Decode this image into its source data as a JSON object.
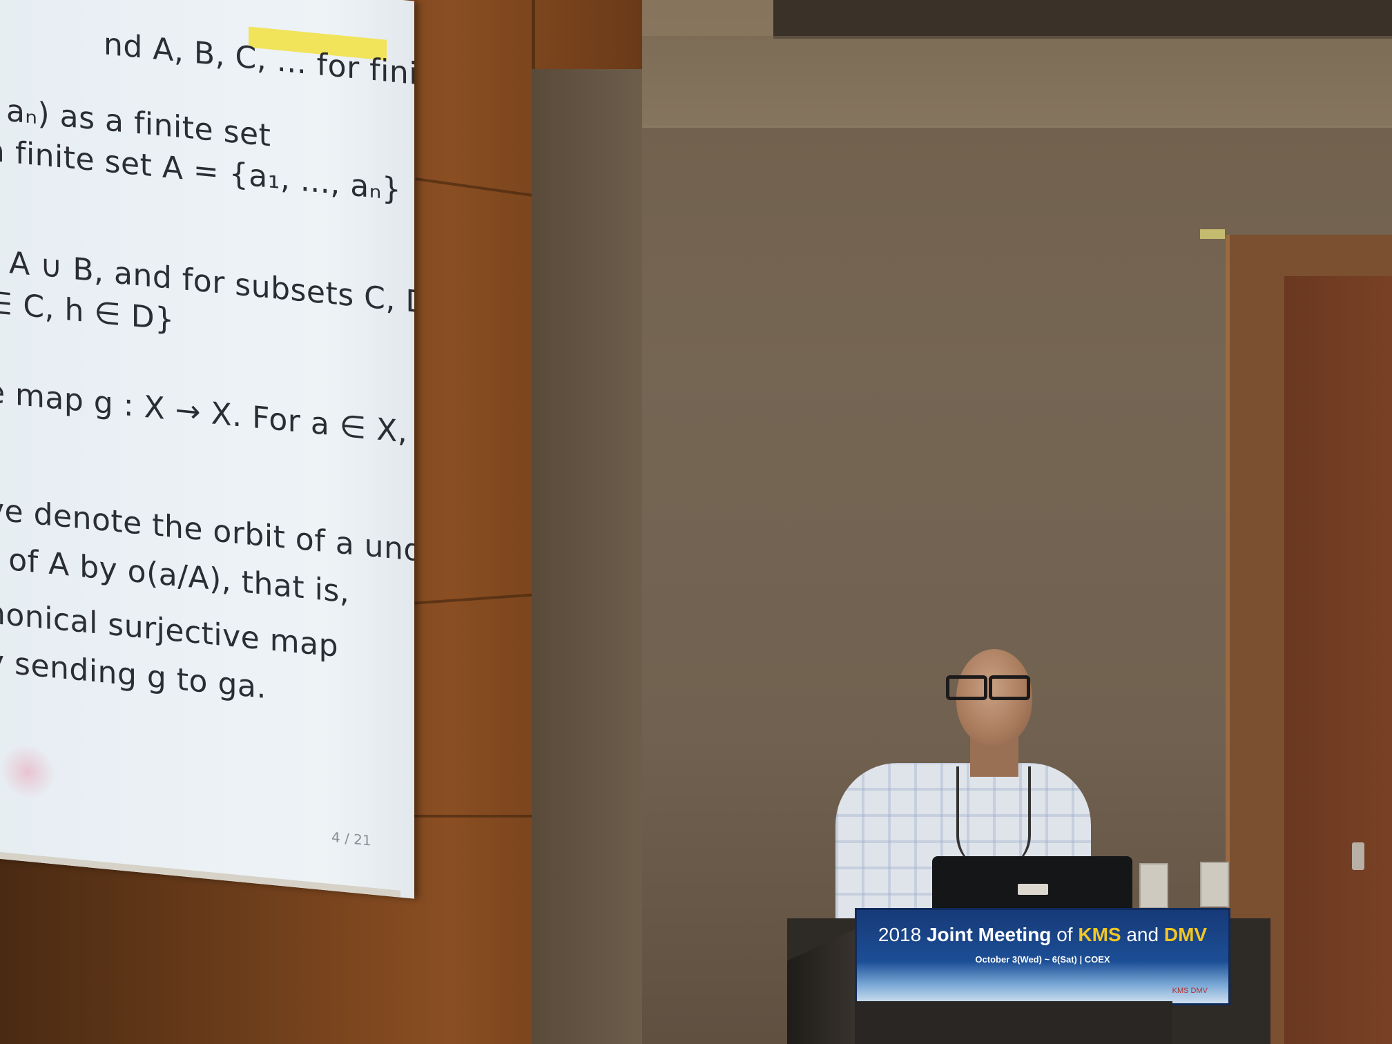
{
  "slide": {
    "lines": [
      "nd A, B, C, ... for finite",
      ", aₙ) as a finite set",
      "a finite set A = {a₁, ..., aₙ}",
      "r A ∪ B, and for subsets C, D",
      "∈ C, h ∈ D}",
      "e map g : X → X. For a ∈ X,",
      "ve denote the orbit of a under",
      "ₐ of A by o(a/A), that is,",
      "nonical surjective map",
      "y sending g to ga."
    ],
    "page_number": "4 / 21"
  },
  "banner": {
    "year": "2018",
    "joint": "Joint Meeting",
    "of": "of",
    "kms": "KMS",
    "and": "and",
    "dmv": "DMV",
    "dates": "October 3(Wed) ~ 6(Sat) | COEX",
    "logos": "KMS DMV"
  },
  "colors": {
    "banner_blue": "#1c4e95",
    "banner_yellow": "#f3c623",
    "screen": "#eef3f6",
    "wood": "#8a4e22",
    "wall": "#756553"
  }
}
